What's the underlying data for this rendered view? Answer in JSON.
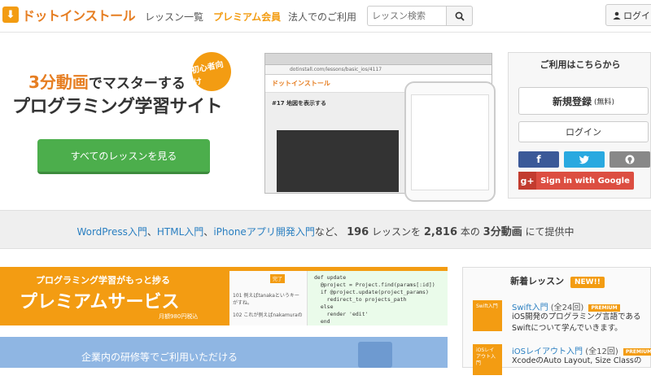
{
  "brand": {
    "logo_icon": "download-arrow-icon",
    "name": "ドットインストール"
  },
  "nav": {
    "lessons": "レッスン一覧",
    "premium": "プレミアム会員",
    "corporate": "法人でのご利用"
  },
  "search": {
    "placeholder": "レッスン検索",
    "icon": "search-icon"
  },
  "login_top": {
    "label": "ログイン",
    "icon": "user-icon"
  },
  "hero": {
    "tagline_highlight": "3分動画",
    "tagline_rest": "でマスターする",
    "tagline_main": "プログラミング学習サイト",
    "badge": "初心者向け",
    "cta": "すべてのレッスンを見る",
    "preview": {
      "url": "dotinstall.com/lessons/basic_ios/4117",
      "site_name": "ドットインストール",
      "lesson_title": "#17 地図を表示する"
    }
  },
  "register": {
    "title": "ご利用はこちらから",
    "signup": "新規登録",
    "signup_note": "(無料)",
    "login": "ログイン",
    "facebook": "f",
    "github_icon": "github-icon",
    "twitter_icon": "twitter-bird-icon",
    "google_mark": "g+",
    "google": "Sign in with Google"
  },
  "stats": {
    "links": [
      "WordPress入門",
      "HTML入門",
      "iPhoneアプリ開発入門"
    ],
    "sep1": "、",
    "sep2": "、",
    "suffix1": "など、",
    "lesson_count": "196",
    "suffix2": "レッスンを",
    "video_count": "2,816",
    "suffix3": "本の",
    "highlight": "3分動画",
    "suffix4": "にて提供中"
  },
  "premium": {
    "sub": "プログラミング学習がもっと捗る",
    "title": "プレミアムサービス",
    "price": "月額980円税込",
    "done": "完了",
    "comment1": "101 例えばtanakaというキーがすね。",
    "comment2": "102 これが例えばnakamuraの",
    "code": "def update\n  @project = Project.find(params[:id])\n  if @project.update(project_params)\n    redirect_to projects_path\n  else\n    render 'edit'\n  end"
  },
  "corporate": {
    "text": "企業内の研修等でご利用いただける"
  },
  "new_lessons": {
    "title": "新着レッスン",
    "new_badge": "NEW!!",
    "items": [
      {
        "thumb": "Swift入門",
        "name": "Swift入門",
        "count": "(全24回)",
        "badge": "PREMIUM",
        "desc": "iOS開発のプログラミング言語であるSwiftについて学んでいきます。"
      },
      {
        "thumb": "iOSレイアウト入門",
        "name": "iOSレイアウト入門",
        "count": "(全12回)",
        "badge": "PREMIUM",
        "desc": "XcodeのAuto Layout, Size Classの"
      }
    ]
  }
}
